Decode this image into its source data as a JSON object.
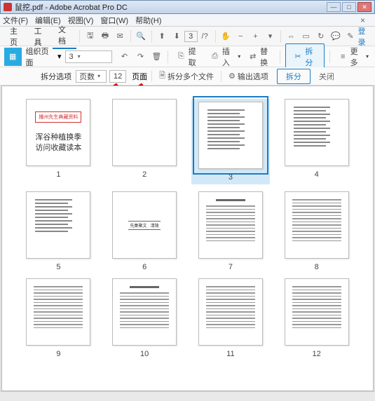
{
  "titlebar": {
    "filename": "鼠挖.pdf",
    "appname": "Adobe Acrobat Pro DC"
  },
  "menubar": {
    "file": "文件(F)",
    "edit": "编辑(E)",
    "view": "视图(V)",
    "window": "窗口(W)",
    "help": "帮助(H)"
  },
  "tb1": {
    "home": "主页",
    "tools": "工具",
    "doc": "文档",
    "page_current": "3",
    "login": "登录"
  },
  "tb2": {
    "organize": "组织页面",
    "page_dd": "3",
    "extract": "提取",
    "insert": "插入",
    "replace": "替换",
    "split": "拆分",
    "more": "更多"
  },
  "tb3": {
    "split_opts": "拆分选项",
    "mode_dd": "页数",
    "count": "12",
    "pages": "页面",
    "split_multi": "拆分多个文件",
    "output_opts": "输出选项",
    "split_btn": "拆分",
    "close": "关闭"
  },
  "cover": {
    "title": "播州先生典藏资料",
    "sub1": "浑谷种植换季",
    "sub2": "访问收藏读本"
  },
  "thumb6_title": "先集聚文 · 清陵",
  "page_labels": [
    "1",
    "2",
    "3",
    "4",
    "5",
    "6",
    "7",
    "8",
    "9",
    "10",
    "11",
    "12"
  ],
  "chart_data": null
}
